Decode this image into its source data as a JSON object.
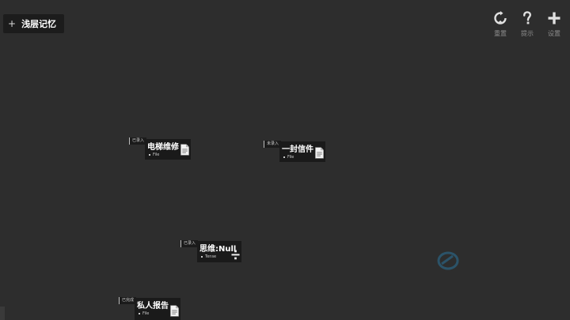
{
  "memory_tab": {
    "plus": "+",
    "label": "浅层记忆"
  },
  "toolbar": [
    {
      "name": "reset-button",
      "icon": "refresh-icon",
      "label": "重置"
    },
    {
      "name": "hint-button",
      "icon": "question-icon",
      "label": "提示"
    },
    {
      "name": "settings-button",
      "icon": "plus-icon",
      "label": "设置"
    }
  ],
  "nodes": [
    {
      "tag": "已录入",
      "title": "电梯维修",
      "sub": "File",
      "icon": "file-icon"
    },
    {
      "tag": "未录入",
      "title": "一封信件",
      "sub": "File",
      "icon": "file-icon"
    },
    {
      "tag": "已录入",
      "title": "思维:Null",
      "sub": "Tense",
      "icon": "divide-icon"
    },
    {
      "tag": "已完成",
      "title": "私人报告",
      "sub": "File",
      "icon": "file-icon"
    }
  ],
  "colors": {
    "background": "#2d2d2d",
    "card": "#1a1a1a",
    "text": "#ffffff",
    "muted": "#8c8c8c"
  }
}
